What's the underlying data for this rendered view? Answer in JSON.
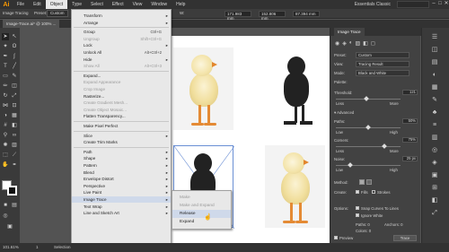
{
  "app": {
    "logo": "Ai",
    "menus": [
      "File",
      "Edit",
      "Object",
      "Type",
      "Select",
      "Effect",
      "View",
      "Window",
      "Help"
    ],
    "active_menu": "Object",
    "workspace": "Essentials Classic",
    "win_controls": [
      "–",
      "□",
      "✕"
    ]
  },
  "controlbar": {
    "preset_label": "Preset:",
    "preset_value": "Custom",
    "view_label": "View:",
    "w_value": "171.983 mm",
    "h_value": "152.806 mm",
    "x_value": "87.394 mm"
  },
  "doc": {
    "tab_title": "Image-Trace.ai* @ 100% ...",
    "left_label": "Image Tracing"
  },
  "object_menu": {
    "items": [
      {
        "label": "Transform",
        "submenu": true
      },
      {
        "label": "Arrange",
        "submenu": true
      },
      {
        "sep": true
      },
      {
        "label": "Group",
        "shortcut": "Ctrl+G"
      },
      {
        "label": "Ungroup",
        "shortcut": "Shift+Ctrl+G",
        "disabled": true
      },
      {
        "label": "Lock",
        "submenu": true
      },
      {
        "label": "Unlock All",
        "shortcut": "Alt+Ctrl+2"
      },
      {
        "label": "Hide",
        "submenu": true
      },
      {
        "label": "Show All",
        "shortcut": "Alt+Ctrl+3",
        "disabled": true
      },
      {
        "sep": true
      },
      {
        "label": "Expand..."
      },
      {
        "label": "Expand Appearance",
        "disabled": true
      },
      {
        "label": "Crop Image",
        "disabled": true
      },
      {
        "label": "Rasterize..."
      },
      {
        "label": "Create Gradient Mesh...",
        "disabled": true
      },
      {
        "label": "Create Object Mosaic...",
        "disabled": true
      },
      {
        "label": "Flatten Transparency..."
      },
      {
        "sep": true
      },
      {
        "label": "Make Pixel Perfect"
      },
      {
        "sep": true
      },
      {
        "label": "Slice",
        "submenu": true
      },
      {
        "label": "Create Trim Marks"
      },
      {
        "sep": true
      },
      {
        "label": "Path",
        "submenu": true
      },
      {
        "label": "Shape",
        "submenu": true
      },
      {
        "label": "Pattern",
        "submenu": true
      },
      {
        "label": "Blend",
        "submenu": true
      },
      {
        "label": "Envelope Distort",
        "submenu": true
      },
      {
        "label": "Perspective",
        "submenu": true
      },
      {
        "label": "Live Paint",
        "submenu": true
      },
      {
        "label": "Image Trace",
        "submenu": true,
        "highlight": true
      },
      {
        "label": "Text Wrap",
        "submenu": true
      },
      {
        "label": "Line and Sketch Art",
        "submenu": true
      }
    ]
  },
  "trace_submenu": {
    "items": [
      {
        "label": "Make",
        "disabled": true
      },
      {
        "label": "Make and Expand",
        "disabled": true
      },
      {
        "label": "Release",
        "highlight": true
      },
      {
        "label": "Expand"
      }
    ]
  },
  "panel": {
    "title": "Image Trace",
    "preset_label": "Preset:",
    "preset_value": "Custom",
    "view_label": "View:",
    "view_value": "Tracing Result",
    "mode_label": "Mode:",
    "mode_value": "Black and White",
    "palette_label": "Palette:",
    "threshold_label": "Threshold:",
    "threshold_value": "121",
    "threshold_fraction": 0.47,
    "less": "Less",
    "more": "More",
    "advanced": "Advanced",
    "paths_label": "Paths:",
    "paths_value": "50%",
    "paths_fraction": 0.5,
    "corners_label": "Corners:",
    "corners_value": "75%",
    "corners_fraction": 0.75,
    "noise_label": "Noise:",
    "noise_value": "25 px",
    "noise_fraction": 0.22,
    "low": "Low",
    "high": "High",
    "method_label": "Method:",
    "create_label": "Create:",
    "fills": "Fills",
    "strokes": "Strokes",
    "options_label": "Options:",
    "snap": "Snap Curves To Lines",
    "ignore_white": "Ignore White",
    "paths_stat": "Paths: 0",
    "anchors_stat": "Anchors: 0",
    "colors_stat": "Colors: 0",
    "preview": "Preview",
    "trace_btn": "Trace"
  },
  "status": {
    "zoom": "101.61%",
    "page": "1",
    "tool": "Selection"
  }
}
